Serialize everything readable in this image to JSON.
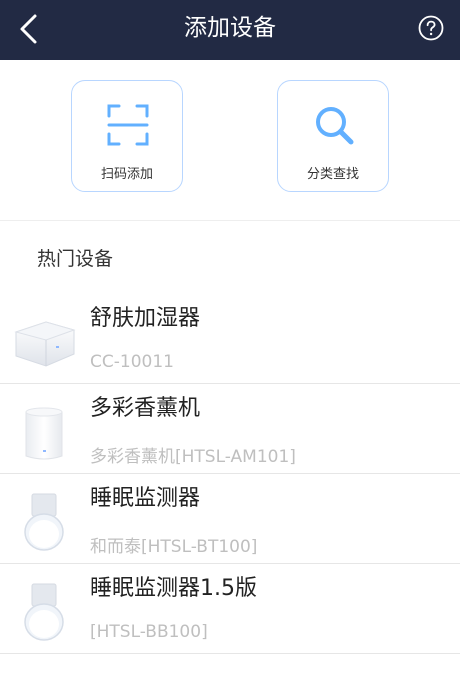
{
  "header": {
    "title": "添加设备",
    "back_icon": "chevron-left-icon",
    "help_icon": "question-circle-icon"
  },
  "actions": [
    {
      "label": "扫码添加",
      "icon": "scan-icon"
    },
    {
      "label": "分类查找",
      "icon": "search-icon"
    }
  ],
  "section": {
    "title": "热门设备"
  },
  "devices": [
    {
      "name": "舒肤加湿器",
      "model": "CC-10011",
      "icon": "humidifier-image"
    },
    {
      "name": "多彩香薰机",
      "model": "多彩香薰机[HTSL-AM101]",
      "icon": "aroma-diffuser-image"
    },
    {
      "name": "睡眠监测器",
      "model": "和而泰[HTSL-BT100]",
      "icon": "sleep-monitor-image"
    },
    {
      "name": "睡眠监测器1.5版",
      "model": "[HTSL-BB100]",
      "icon": "sleep-monitor-image"
    }
  ],
  "colors": {
    "header_bg": "#222a44",
    "accent": "#62b0ff",
    "card_border": "#b8d6ff",
    "muted_text": "#bfbfbf"
  }
}
